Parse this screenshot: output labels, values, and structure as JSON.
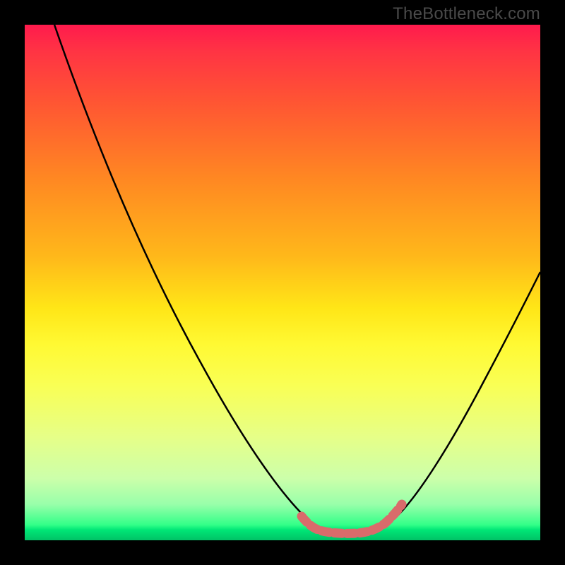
{
  "watermark": "TheBottleneck.com",
  "chart_data": {
    "type": "line",
    "title": "",
    "xlabel": "",
    "ylabel": "",
    "xlim": [
      0,
      100
    ],
    "ylim": [
      0,
      100
    ],
    "grid": false,
    "series": [
      {
        "name": "bottleneck-curve",
        "x": [
          10,
          15,
          20,
          25,
          30,
          35,
          40,
          45,
          50,
          52,
          55,
          58,
          60,
          62,
          65,
          68,
          70,
          75,
          80,
          85,
          90,
          95,
          100
        ],
        "y": [
          100,
          90,
          80,
          70,
          60,
          50,
          40,
          30,
          18,
          10,
          5,
          2,
          1,
          1,
          1,
          2,
          5,
          10,
          20,
          30,
          40,
          48,
          55
        ]
      }
    ],
    "markers": {
      "name": "highlight-band",
      "x": [
        55,
        58,
        60,
        62,
        65,
        68
      ],
      "y": [
        5,
        2,
        1,
        1,
        1,
        2
      ],
      "color": "#d96b6b"
    },
    "background": {
      "type": "vertical-gradient",
      "stops": [
        {
          "pos": 0,
          "color": "#ff1a4d"
        },
        {
          "pos": 50,
          "color": "#ffe617"
        },
        {
          "pos": 100,
          "color": "#00c266"
        }
      ]
    }
  }
}
